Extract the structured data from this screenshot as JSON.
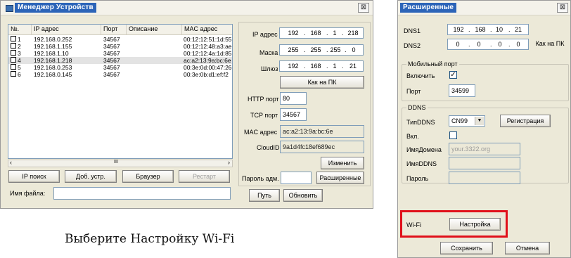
{
  "main_window": {
    "title": "Менеджер Устройств",
    "close": "⊠",
    "list_headers": [
      "№.",
      "IP адрес",
      "Порт",
      "Описание",
      "MAC адрес"
    ],
    "rows": [
      {
        "num": "1",
        "ip": "192.168.0.252",
        "port": "34567",
        "desc": "",
        "mac": "00:12:12:51:1d:55"
      },
      {
        "num": "2",
        "ip": "192.168.1.155",
        "port": "34567",
        "desc": "",
        "mac": "00:12:12:48:a3:ae"
      },
      {
        "num": "3",
        "ip": "192.168.1.10",
        "port": "34567",
        "desc": "",
        "mac": "00:12:12:4a:1d:85"
      },
      {
        "num": "4",
        "ip": "192.168.1.218",
        "port": "34567",
        "desc": "",
        "mac": "ac:a2:13:9a:bc:6e"
      },
      {
        "num": "5",
        "ip": "192.168.0.253",
        "port": "34567",
        "desc": "",
        "mac": "00:3e:0d:00:47:26"
      },
      {
        "num": "6",
        "ip": "192.168.0.145",
        "port": "34567",
        "desc": "",
        "mac": "00:3e:0b:d1:ef:f2"
      }
    ],
    "scroll_mark": "III",
    "buttons": {
      "ip_search": "IP поиск",
      "add_device": "Доб. устр.",
      "browser": "Браузер",
      "restart": "Рестарт"
    },
    "file_label": "Имя файла:",
    "file_value": "",
    "right": {
      "ip_label": "IP адрес",
      "ip": [
        "192",
        "168",
        "1",
        "218"
      ],
      "mask_label": "Маска",
      "mask": [
        "255",
        "255",
        "255",
        "0"
      ],
      "gateway_label": "Шлюз",
      "gateway": [
        "192",
        "168",
        "1",
        "21"
      ],
      "as_pc": "Как на ПК",
      "http_label": "HTTP порт",
      "http": "80",
      "tcp_label": "TCP порт",
      "tcp": "34567",
      "mac_label": "MAC адрес",
      "mac": "ac:a2:13:9a:bc:6e",
      "cloud_label": "CloudID",
      "cloud": "9a1d4fc18ef689ec",
      "change": "Изменить",
      "admin_pass_label": "Пароль адм.",
      "admin_pass": "",
      "advanced": "Расширенные",
      "path": "Путь",
      "refresh": "Обновить"
    }
  },
  "caption": "Выберите Настройку Wi-Fi",
  "adv_window": {
    "title": "Расширенные",
    "close": "⊠",
    "dns1_label": "DNS1",
    "dns1": [
      "192",
      "168",
      "10",
      "21"
    ],
    "dns2_label": "DNS2",
    "dns2": [
      "0",
      "0",
      "0",
      "0"
    ],
    "as_pc": "Как на ПК",
    "mobile_group": "Мобильный порт",
    "enable_label": "Включить",
    "enable_checked": "✓",
    "port_label": "Порт",
    "port": "34599",
    "ddns_group": "DDNS",
    "ddns_type_label": "ТипDDNS",
    "ddns_type": "CN99",
    "register": "Регистрация",
    "on_label": "Вкл.",
    "domain_label": "ИмяДомена",
    "domain_placeholder": "your.3322.org",
    "ddns_name_label": "ИмяDDNS",
    "password_label": "Пароль",
    "wifi_label": "Wi-Fi",
    "wifi_button": "Настройка",
    "save": "Сохранить",
    "cancel": "Отмена",
    "highlight_color": "#e0101a"
  }
}
